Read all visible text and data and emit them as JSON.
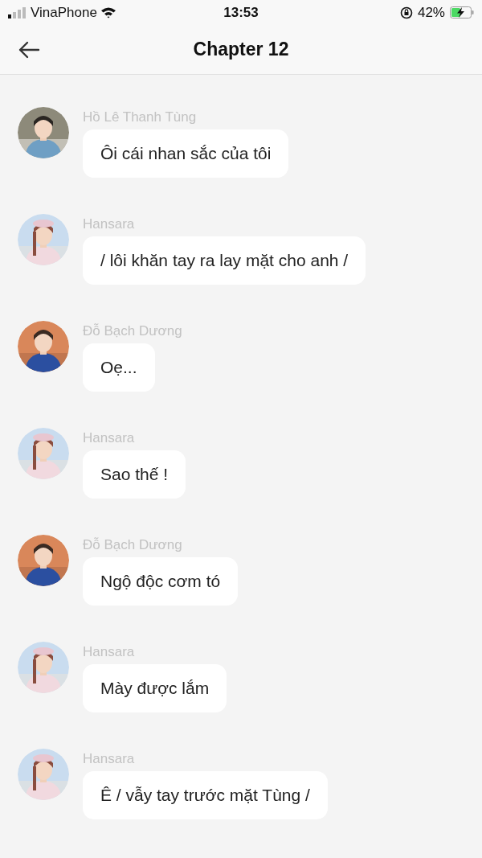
{
  "status_bar": {
    "carrier": "VinaPhone",
    "time": "13:53",
    "battery": "42%"
  },
  "header": {
    "title": "Chapter 12"
  },
  "messages": [
    {
      "name": "Hồ Lê Thanh Tùng",
      "text": "Ôi cái nhan sắc của tôi"
    },
    {
      "name": "Hansara",
      "text": "/ lôi khăn tay ra lay mặt cho anh /"
    },
    {
      "name": "Đỗ Bạch Dương",
      "text": "Oẹ..."
    },
    {
      "name": "Hansara",
      "text": "Sao thế !"
    },
    {
      "name": "Đỗ Bạch Dương",
      "text": "Ngộ độc cơm tó"
    },
    {
      "name": "Hansara",
      "text": "Mày được lắm"
    },
    {
      "name": "Hansara",
      "text": "Ê / vẫy tay trước mặt Tùng /"
    }
  ]
}
